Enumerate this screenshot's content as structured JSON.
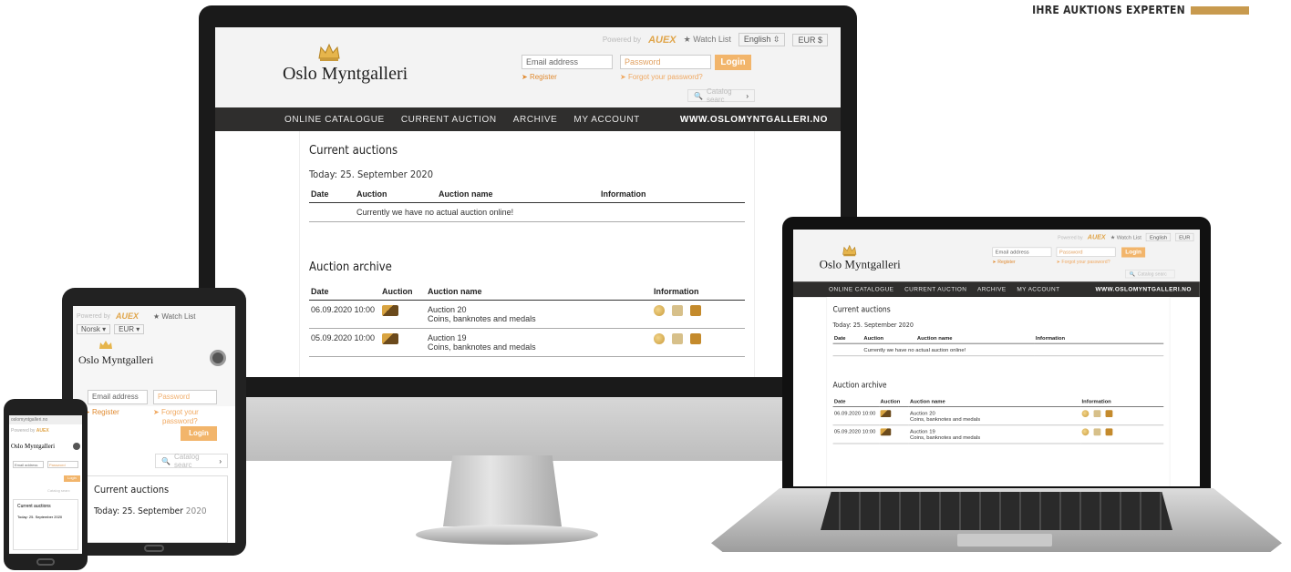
{
  "corner_brand": {
    "text": "IHRE AUKTIONS EXPERTEN"
  },
  "site": {
    "powered_by": "Powered by",
    "auex": "AUEX",
    "watch_list": "Watch List",
    "language": "English",
    "currency": "EUR",
    "logo_text": "Oslo Myntgalleri",
    "email_placeholder": "Email address",
    "password_placeholder": "Password",
    "login_label": "Login",
    "register_label": "Register",
    "forgot_label": "Forgot your password?",
    "catalog_search": "Catalog searc",
    "nav": [
      "ONLINE CATALOGUE",
      "CURRENT AUCTION",
      "ARCHIVE",
      "MY ACCOUNT",
      "WWW.OSLOMYNTGALLERI.NO"
    ],
    "current_title": "Current auctions",
    "today": "Today: 25. September 2020",
    "current_headers": [
      "Date",
      "Auction",
      "Auction name",
      "Information"
    ],
    "no_auction": "Currently we have no actual auction online!",
    "archive_title": "Auction archive",
    "archive_headers": [
      "Date",
      "Auction",
      "Auction name",
      "Information"
    ],
    "archive_rows": [
      {
        "date": "06.09.2020 10:00",
        "name": "Auction 20",
        "sub": "Coins, banknotes and medals"
      },
      {
        "date": "05.09.2020 10:00",
        "name": "Auction 19",
        "sub": "Coins, banknotes and medals"
      }
    ]
  },
  "tablet": {
    "language": "Norsk",
    "currency": "EUR",
    "forgot_line1": "Forgot your",
    "forgot_line2": "password?",
    "current_title": "Current auctions",
    "today_prefix": "Today: 25. September",
    "today_year": "2020"
  },
  "phone": {
    "url": "oslomyntgalleri.no",
    "current_title": "Current auctions",
    "today": "Today: 25. September 2020"
  }
}
